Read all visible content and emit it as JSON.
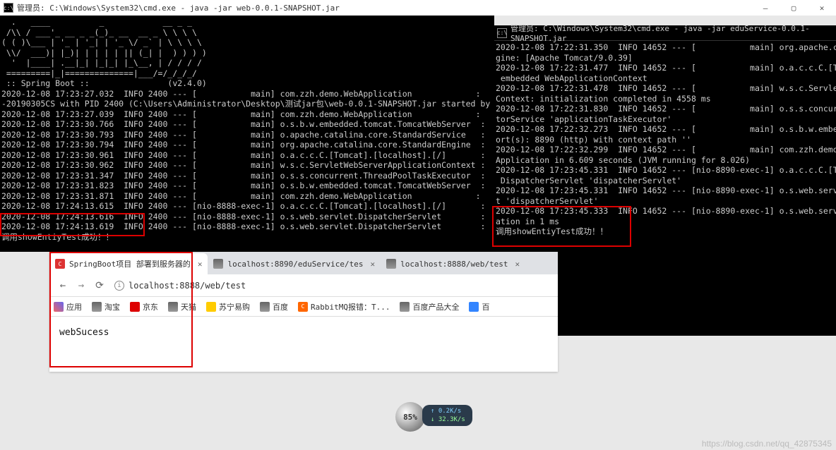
{
  "mainWindow": {
    "title": "管理员: C:\\Windows\\System32\\cmd.exe - java  -jar web-0.0.1-SNAPSHOT.jar",
    "min": "—",
    "max": "▢",
    "close": "✕"
  },
  "term1": {
    "ascii1": "  .   ____          _            __ _ _",
    "ascii2": " /\\\\ / ___'_ __ _ _(_)_ __  __ _ \\ \\ \\ \\",
    "ascii3": "( ( )\\___ | '_ | '_| | '_ \\/ _` | \\ \\ \\ \\",
    "ascii4": " \\\\/  ___)| |_)| | | | | || (_| |  ) ) ) )",
    "ascii5": "  '  |____| .__|_| |_|_| |_\\__, | / / / /",
    "ascii6": " =========|_|==============|___/=/_/_/_/",
    "ascii7": " :: Spring Boot ::                (v2.4.0)",
    "l1": "2020-12-08 17:23:27.032  INFO 2400 --- [           main] com.zzh.demo.WebApplication             :",
    "l2": "-20190305CS with PID 2400 (C:\\Users\\Administrator\\Desktop\\测试jar包\\web-0.0.1-SNAPSHOT.jar started by",
    "l3": "2020-12-08 17:23:27.039  INFO 2400 --- [           main] com.zzh.demo.WebApplication             :",
    "l4": "2020-12-08 17:23:30.766  INFO 2400 --- [           main] o.s.b.w.embedded.tomcat.TomcatWebServer  :",
    "l5": "2020-12-08 17:23:30.793  INFO 2400 --- [           main] o.apache.catalina.core.StandardService   :",
    "l6": "2020-12-08 17:23:30.794  INFO 2400 --- [           main] org.apache.catalina.core.StandardEngine  :",
    "l7": "2020-12-08 17:23:30.961  INFO 2400 --- [           main] o.a.c.c.C.[Tomcat].[localhost].[/]       :",
    "l8": "2020-12-08 17:23:30.962  INFO 2400 --- [           main] w.s.c.ServletWebServerApplicationContext :",
    "l9": "2020-12-08 17:23:31.347  INFO 2400 --- [           main] o.s.s.concurrent.ThreadPoolTaskExecutor  :",
    "l10": "2020-12-08 17:23:31.823  INFO 2400 --- [           main] o.s.b.w.embedded.tomcat.TomcatWebServer  :",
    "l11": "2020-12-08 17:23:31.871  INFO 2400 --- [           main] com.zzh.demo.WebApplication             :",
    "l12": "2020-12-08 17:24:13.615  INFO 2400 --- [nio-8888-exec-1] o.a.c.c.C.[Tomcat].[localhost].[/]       :",
    "l13": "2020-12-08 17:24:13.616  INFO 2400 --- [nio-8888-exec-1] o.s.web.servlet.DispatcherServlet        :",
    "l14": "2020-12-08 17:24:13.619  INFO 2400 --- [nio-8888-exec-1] o.s.web.servlet.DispatcherServlet        :",
    "l15": "调用showEntiyTest成功！！"
  },
  "term2Title": "管理员: C:\\Windows\\System32\\cmd.exe - java  -jar eduService-0.0.1-SNAPSHOT.jar",
  "term2": {
    "l1": "2020-12-08 17:22:31.350  INFO 14652 --- [           main] org.apache.c",
    "l2": "gine: [Apache Tomcat/9.0.39]",
    "l3": "2020-12-08 17:22:31.477  INFO 14652 --- [           main] o.a.c.c.C.[T",
    "l4": " embedded WebApplicationContext",
    "l5": "2020-12-08 17:22:31.478  INFO 14652 --- [           main] w.s.c.Servle",
    "l6": "Context: initialization completed in 4558 ms",
    "l7": "2020-12-08 17:22:31.830  INFO 14652 --- [           main] o.s.s.concur",
    "l8": "torService 'applicationTaskExecutor'",
    "l9": "2020-12-08 17:22:32.273  INFO 14652 --- [           main] o.s.b.w.embe",
    "l10": "ort(s): 8890 (http) with context path ''",
    "l11": "2020-12-08 17:22:32.299  INFO 14652 --- [           main] com.zzh.demo",
    "l12": "Application in 6.609 seconds (JVM running for 8.026)",
    "l13": "2020-12-08 17:23:45.331  INFO 14652 --- [nio-8890-exec-1] o.a.c.c.C.[T",
    "l14": " DispatcherServlet 'dispatcherServlet'",
    "l15": "2020-12-08 17:23:45.331  INFO 14652 --- [nio-8890-exec-1] o.s.web.serv",
    "l16": "t 'dispatcherServlet'",
    "l17": "2020-12-08 17:23:45.333  INFO 14652 --- [nio-8890-exec-1] o.s.web.serv",
    "l18": "ation in 1 ms",
    "l19": "调用showEntiyTest成功！！"
  },
  "browser": {
    "tabs": [
      {
        "label": "SpringBoot项目 部署到服务器的"
      },
      {
        "label": "localhost:8890/eduService/tes"
      },
      {
        "label": "localhost:8888/web/test"
      }
    ],
    "nav": {
      "back": "←",
      "fwd": "→",
      "reload": "⟳"
    },
    "addr": "localhost:8888/web/test",
    "info": "ⓘ",
    "apps": "应用",
    "bookmarks": [
      {
        "label": "淘宝",
        "c": "#f60"
      },
      {
        "label": "京东",
        "c": "#d00"
      },
      {
        "label": "天猫",
        "c": "#d00"
      },
      {
        "label": "苏宁易购",
        "c": "#fc0"
      },
      {
        "label": "百度",
        "c": "#999"
      },
      {
        "label": "RabbitMQ报错：T...",
        "c": "#d00",
        "orange": true
      },
      {
        "label": "百度产品大全",
        "c": "#999"
      },
      {
        "label": "百",
        "c": "#999"
      }
    ],
    "page": "webSucess"
  },
  "widget": {
    "pct": "85%",
    "up": "↑ 0.2K/s",
    "down": "↓ 32.3K/s"
  },
  "watermark": "https://blog.csdn.net/qq_42875345"
}
